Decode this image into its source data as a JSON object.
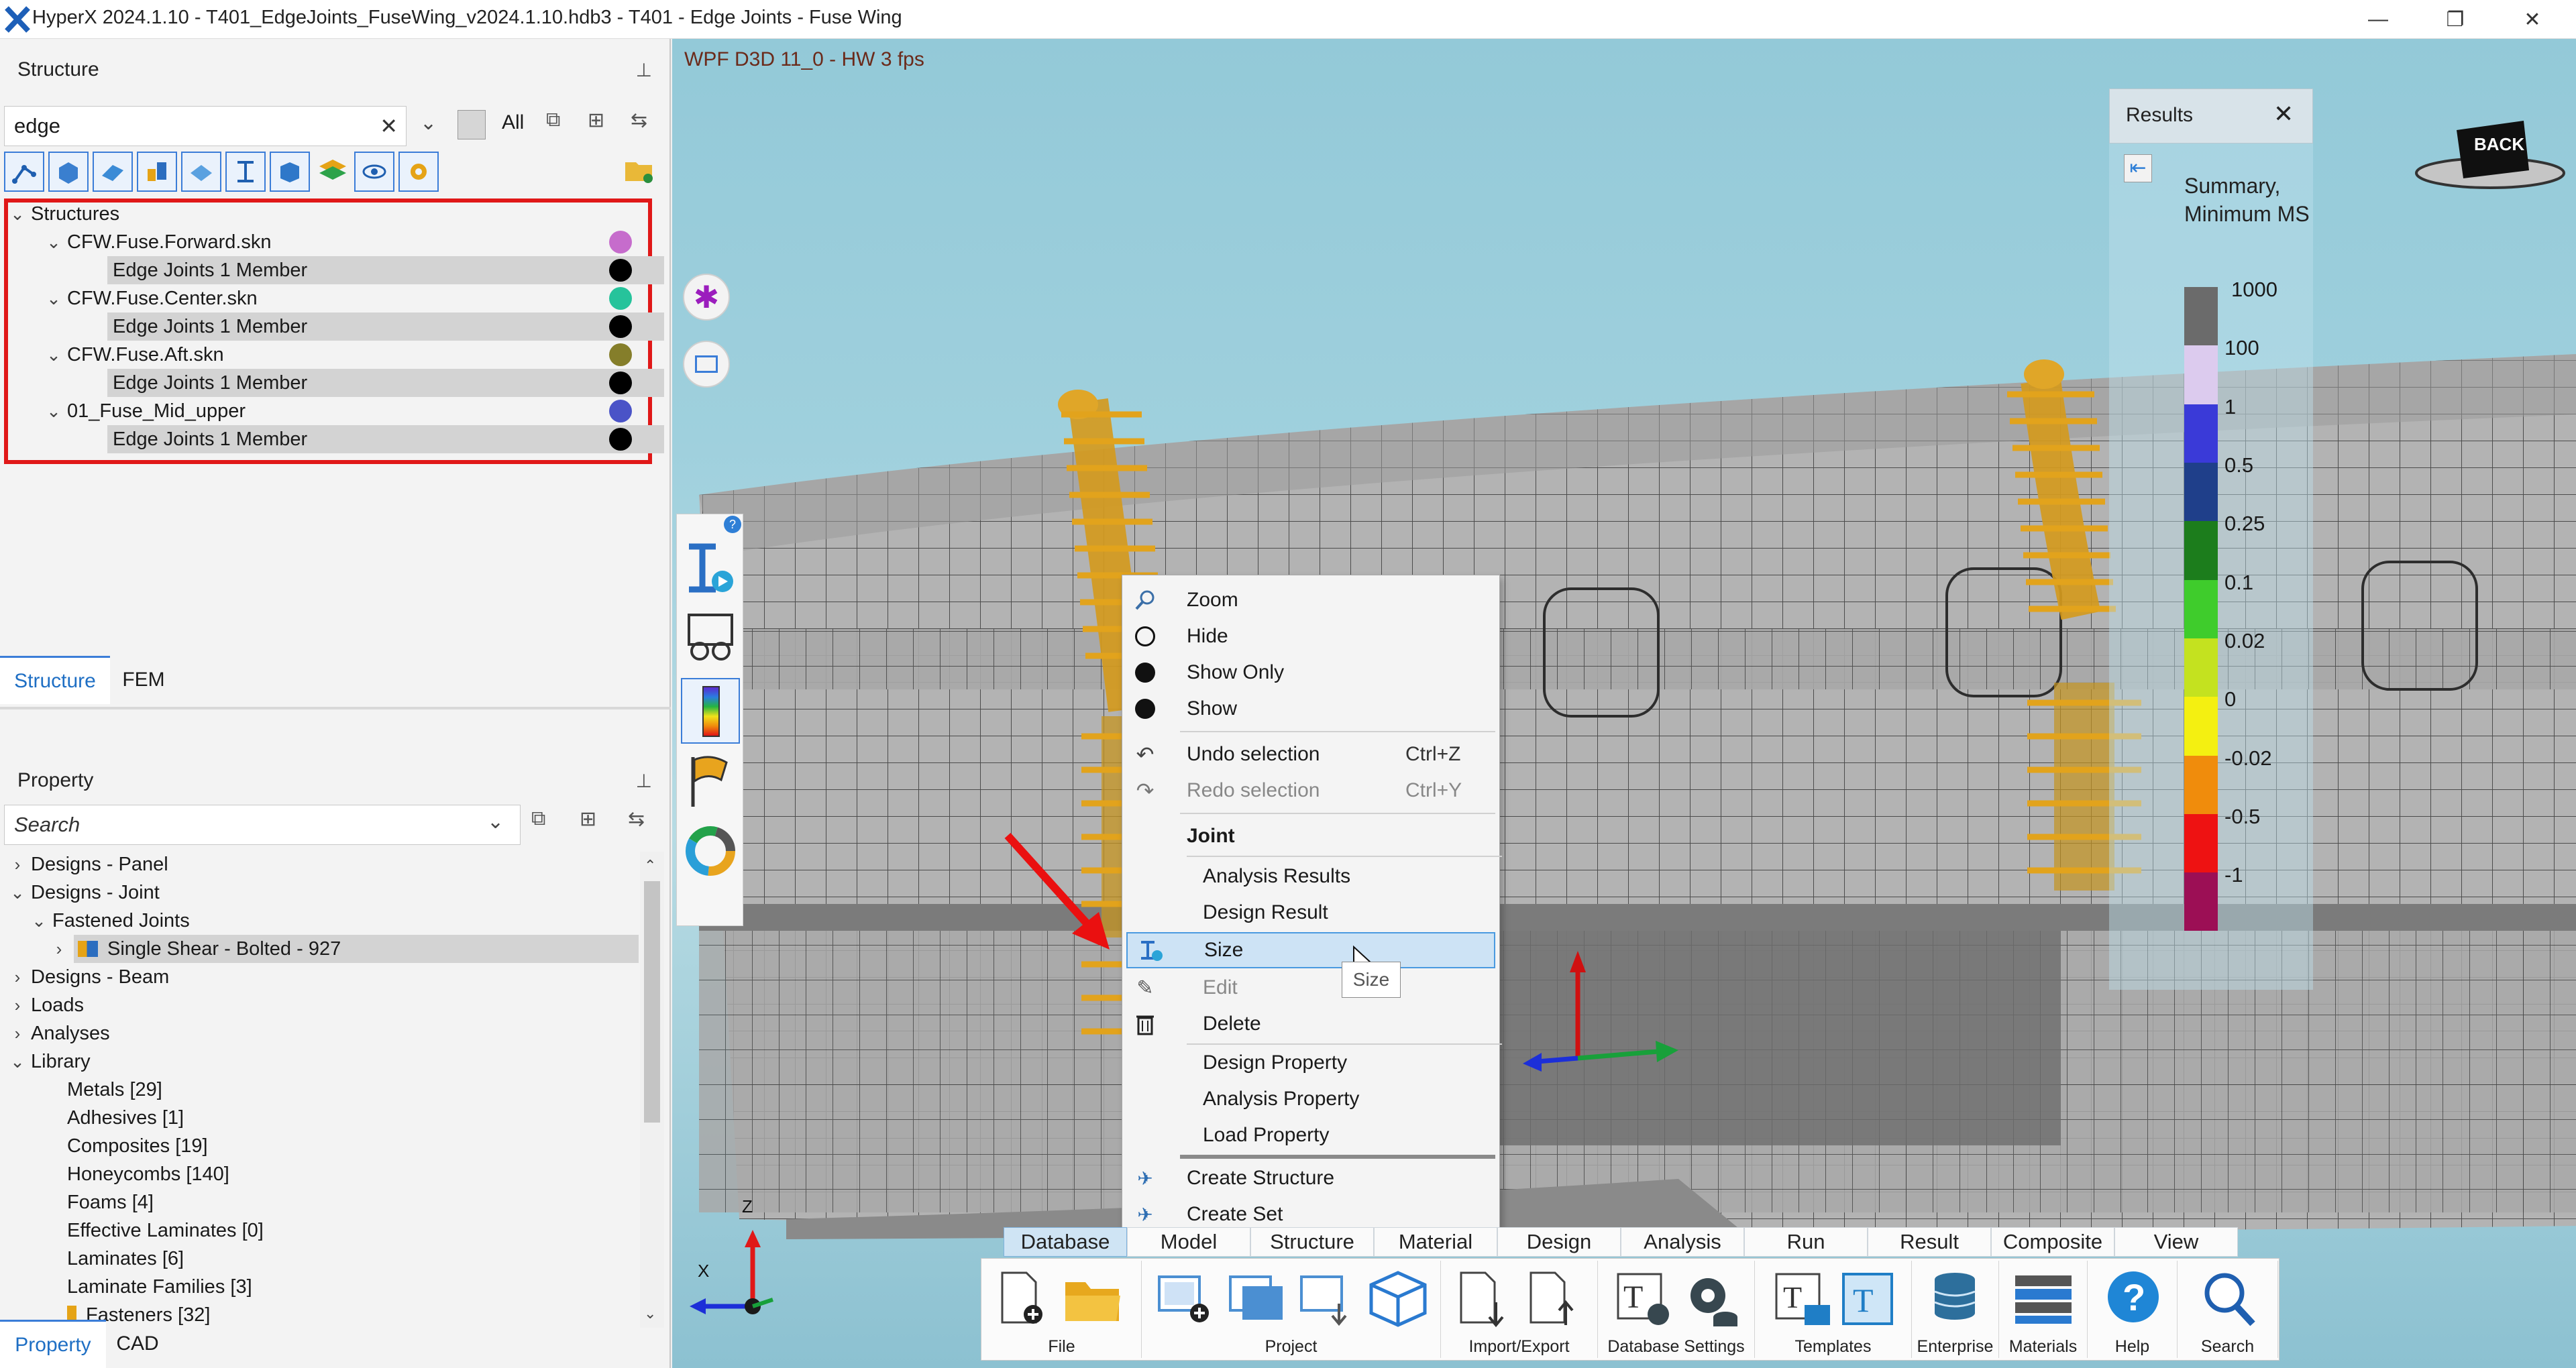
{
  "window": {
    "title": "HyperX 2024.1.10 - T401_EdgeJoints_FuseWing_v2024.1.10.hdb3 - T401 - Edge Joints - Fuse Wing",
    "minimize": "—",
    "maximize": "❐",
    "close": "✕"
  },
  "structure_panel": {
    "title": "Structure",
    "search_value": "edge",
    "filter_all": "All",
    "tree": {
      "root": "Structures",
      "groups": [
        {
          "name": "CFW.Fuse.Forward.skn",
          "color": "#c66ccc",
          "member": "Edge Joints 1 Member"
        },
        {
          "name": "CFW.Fuse.Center.skn",
          "color": "#26c39b",
          "member": "Edge Joints 1 Member"
        },
        {
          "name": "CFW.Fuse.Aft.skn",
          "color": "#857e2a",
          "member": "Edge Joints 1 Member"
        },
        {
          "name": "01_Fuse_Mid_upper",
          "color": "#4a53c7",
          "member": "Edge Joints 1 Member"
        }
      ]
    },
    "tabs": [
      "Structure",
      "FEM"
    ]
  },
  "property_panel": {
    "title": "Property",
    "search_placeholder": "Search",
    "items": [
      {
        "label": "Designs - Panel",
        "count": ""
      },
      {
        "label": "Designs - Joint",
        "count": ""
      },
      {
        "label": "Fastened Joints",
        "count": ""
      },
      {
        "label": "Single Shear - Bolted - 927",
        "count": ""
      },
      {
        "label": "Designs - Beam",
        "count": ""
      },
      {
        "label": "Loads",
        "count": ""
      },
      {
        "label": "Analyses",
        "count": ""
      },
      {
        "label": "Library",
        "count": ""
      },
      {
        "label": "Metals",
        "count": "[29]"
      },
      {
        "label": "Adhesives",
        "count": "[1]"
      },
      {
        "label": "Composites",
        "count": "[19]"
      },
      {
        "label": "Honeycombs",
        "count": "[140]"
      },
      {
        "label": "Foams",
        "count": "[4]"
      },
      {
        "label": "Effective Laminates",
        "count": "[0]"
      },
      {
        "label": "Laminates",
        "count": "[6]"
      },
      {
        "label": "Laminate Families",
        "count": "[3]"
      },
      {
        "label": "Fasteners",
        "count": "[32]"
      }
    ],
    "tabs": [
      "Property",
      "CAD"
    ]
  },
  "viewport": {
    "status": "WPF D3D 11_0 - HW  3 fps",
    "back_label": "BACK",
    "axis_x": "X",
    "axis_z": "Z"
  },
  "results_panel": {
    "title": "Results",
    "summary_title": "Summary,\nMinimum MS",
    "legend": [
      {
        "label": "1000",
        "color": "#6b6b6b"
      },
      {
        "label": "100",
        "color": "#dccbee"
      },
      {
        "label": "1",
        "color": "#3a3ad8"
      },
      {
        "label": "0.5",
        "color": "#1f3f8a"
      },
      {
        "label": "0.25",
        "color": "#1c7d1c"
      },
      {
        "label": "0.1",
        "color": "#3fcc2c"
      },
      {
        "label": "0.02",
        "color": "#c4e21f"
      },
      {
        "label": "0",
        "color": "#f4f011"
      },
      {
        "label": "-0.02",
        "color": "#f08c0c"
      },
      {
        "label": "-0.5",
        "color": "#ee1212"
      },
      {
        "label": "-1",
        "color": "#9c0f55"
      }
    ]
  },
  "context_menu": {
    "items": [
      {
        "label": "Zoom",
        "shortcut": "",
        "icon": "zoom-icon",
        "disabled": false
      },
      {
        "label": "Hide",
        "shortcut": "",
        "icon": "hollow-circle-icon",
        "disabled": false
      },
      {
        "label": "Show Only",
        "shortcut": "",
        "icon": "filled-circle-icon",
        "disabled": false
      },
      {
        "label": "Show",
        "shortcut": "",
        "icon": "filled-circle-icon",
        "disabled": false
      },
      {
        "label": "Undo selection",
        "shortcut": "Ctrl+Z",
        "icon": "undo-icon",
        "disabled": false
      },
      {
        "label": "Redo selection",
        "shortcut": "Ctrl+Y",
        "icon": "redo-icon",
        "disabled": true
      }
    ],
    "section_title": "Joint",
    "joint_items": [
      "Analysis Results",
      "Design Result",
      "Size",
      "Edit",
      "Delete",
      "Design Property",
      "Analysis Property",
      "Load Property"
    ],
    "bottom_items": [
      "Create Structure",
      "Create Set"
    ],
    "tooltip": "Size"
  },
  "ribbon": {
    "tabs": [
      "Database",
      "Model",
      "Structure",
      "Material",
      "Design",
      "Analysis",
      "Run",
      "Result",
      "Composite",
      "View"
    ],
    "groups": [
      "File",
      "Project",
      "Import/Export",
      "Database Settings",
      "Templates",
      "Enterprise",
      "Materials",
      "Help",
      "Search"
    ]
  }
}
